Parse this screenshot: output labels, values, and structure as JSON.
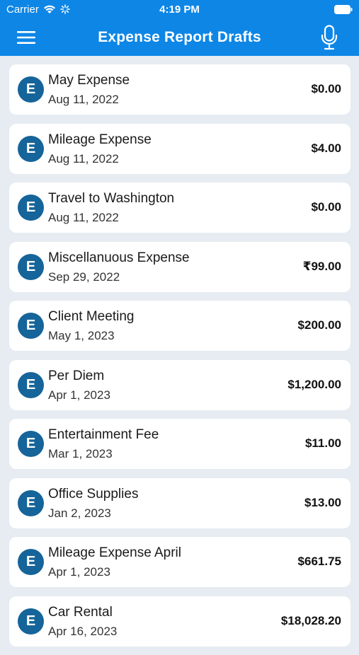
{
  "status_bar": {
    "carrier": "Carrier",
    "time": "4:19 PM",
    "icons": [
      "wifi-icon",
      "activity-icon",
      "battery-icon"
    ]
  },
  "header": {
    "title": "Expense Report Drafts",
    "menu_icon": "hamburger-menu-icon",
    "mic_icon": "microphone-icon",
    "background_color": "#0d86e6"
  },
  "reports": [
    {
      "initial": "E",
      "title": "May Expense",
      "date": "Aug 11, 2022",
      "amount": "$0.00"
    },
    {
      "initial": "E",
      "title": "Mileage Expense",
      "date": "Aug 11, 2022",
      "amount": "$4.00"
    },
    {
      "initial": "E",
      "title": "Travel to Washington",
      "date": "Aug 11, 2022",
      "amount": "$0.00"
    },
    {
      "initial": "E",
      "title": "Miscellanuous Expense",
      "date": "Sep 29, 2022",
      "amount": "₹99.00"
    },
    {
      "initial": "E",
      "title": "Client Meeting",
      "date": "May 1, 2023",
      "amount": "$200.00"
    },
    {
      "initial": "E",
      "title": "Per Diem",
      "date": "Apr 1, 2023",
      "amount": "$1,200.00"
    },
    {
      "initial": "E",
      "title": "Entertainment Fee",
      "date": "Mar 1, 2023",
      "amount": "$11.00"
    },
    {
      "initial": "E",
      "title": "Office Supplies",
      "date": "Jan 2, 2023",
      "amount": "$13.00"
    },
    {
      "initial": "E",
      "title": "Mileage Expense April",
      "date": "Apr 1, 2023",
      "amount": "$661.75"
    },
    {
      "initial": "E",
      "title": "Car Rental",
      "date": "Apr 16, 2023",
      "amount": "$18,028.20"
    }
  ],
  "colors": {
    "avatar": "#15649a",
    "page_background": "#e6ecf1"
  }
}
